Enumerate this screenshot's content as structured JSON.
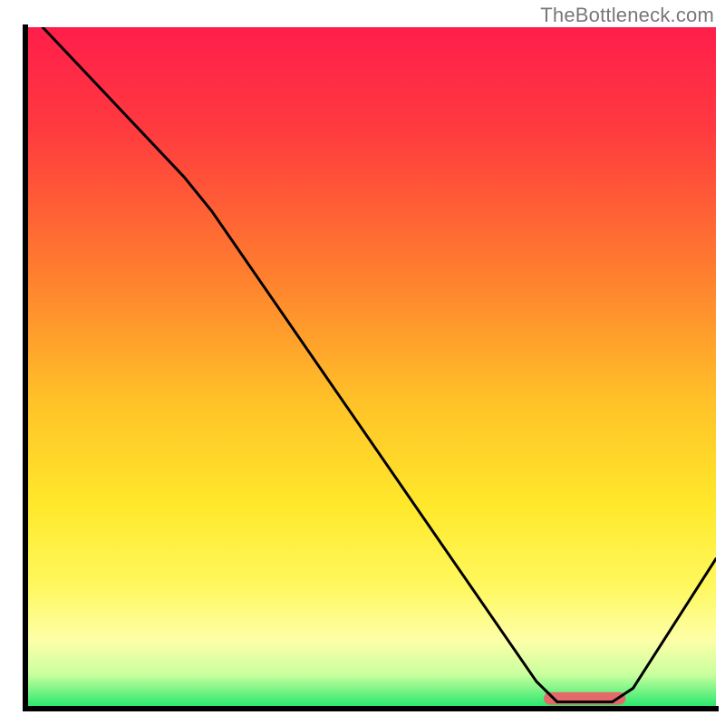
{
  "watermark": "TheBottleneck.com",
  "chart_data": {
    "type": "line",
    "title": "",
    "xlabel": "",
    "ylabel": "",
    "xlim": [
      0,
      100
    ],
    "ylim": [
      0,
      100
    ],
    "background_gradient": {
      "stops": [
        {
          "offset": 0,
          "color": "#ff1e4b"
        },
        {
          "offset": 15,
          "color": "#ff3a3f"
        },
        {
          "offset": 35,
          "color": "#ff7a2f"
        },
        {
          "offset": 55,
          "color": "#ffc228"
        },
        {
          "offset": 70,
          "color": "#ffe82a"
        },
        {
          "offset": 82,
          "color": "#fff85e"
        },
        {
          "offset": 90,
          "color": "#fdffa8"
        },
        {
          "offset": 95,
          "color": "#c9ff9e"
        },
        {
          "offset": 100,
          "color": "#1ee66a"
        }
      ]
    },
    "axis_color": "#000000",
    "axis_width": 6,
    "curve": {
      "stroke": "#000000",
      "stroke_width": 3,
      "points": [
        {
          "x": 2.5,
          "y": 100
        },
        {
          "x": 23,
          "y": 78
        },
        {
          "x": 27,
          "y": 73
        },
        {
          "x": 74,
          "y": 4
        },
        {
          "x": 77,
          "y": 1
        },
        {
          "x": 85,
          "y": 1
        },
        {
          "x": 88,
          "y": 3
        },
        {
          "x": 100,
          "y": 22
        }
      ]
    },
    "marker": {
      "fill": "#e46a6a",
      "points": [
        {
          "x": 76,
          "y": 1.5
        },
        {
          "x": 86,
          "y": 1.5
        }
      ],
      "radius_x": 2,
      "height_y": 1.2
    }
  }
}
